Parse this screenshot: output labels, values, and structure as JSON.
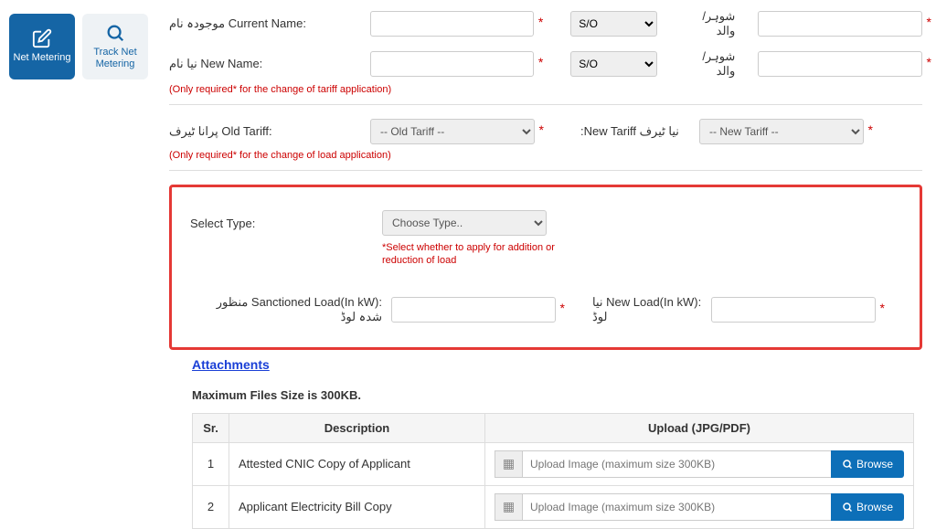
{
  "sidebar": {
    "netMetering": "Net Metering",
    "trackNet": "Track Net Metering"
  },
  "currentName": {
    "label": ":Current Name",
    "urdu": "موجودہ نام"
  },
  "newName": {
    "label": ":New Name",
    "urdu": "نیا نام"
  },
  "relation": {
    "selected": "S/O",
    "urdu": "شوہر/ والد"
  },
  "tariffNote": "(Only required* for the change of tariff application)",
  "oldTariff": {
    "label": ":Old Tariff",
    "urdu": "پرانا ٹیرف",
    "placeholder": "-- Old Tariff --"
  },
  "newTariff": {
    "label": "New Tariff:",
    "urdu": "نیا ٹیرف",
    "placeholder": "-- New Tariff --"
  },
  "loadNote": "(Only required* for the change of load application)",
  "selectType": {
    "label": "Select Type:",
    "placeholder": "Choose Type..",
    "note": "*Select whether to apply for addition or reduction of load"
  },
  "sanctioned": {
    "label": ":Sanctioned Load(In kW)",
    "urdu": "منظور شدہ لوڈ"
  },
  "newLoad": {
    "label": ":New Load(In kW)",
    "urdu": "نیا لوڈ"
  },
  "attachments": {
    "title": "Attachments",
    "maxNote": "Maximum Files Size is 300KB.",
    "headers": {
      "sr": "Sr.",
      "desc": "Description",
      "upload": "Upload (JPG/PDF)"
    },
    "rows": [
      {
        "sr": "1",
        "desc": "Attested CNIC Copy of Applicant"
      },
      {
        "sr": "2",
        "desc": "Applicant Electricity Bill Copy"
      }
    ],
    "uploadPlaceholder": "Upload Image (maximum size 300KB)",
    "browse": "Browse"
  }
}
